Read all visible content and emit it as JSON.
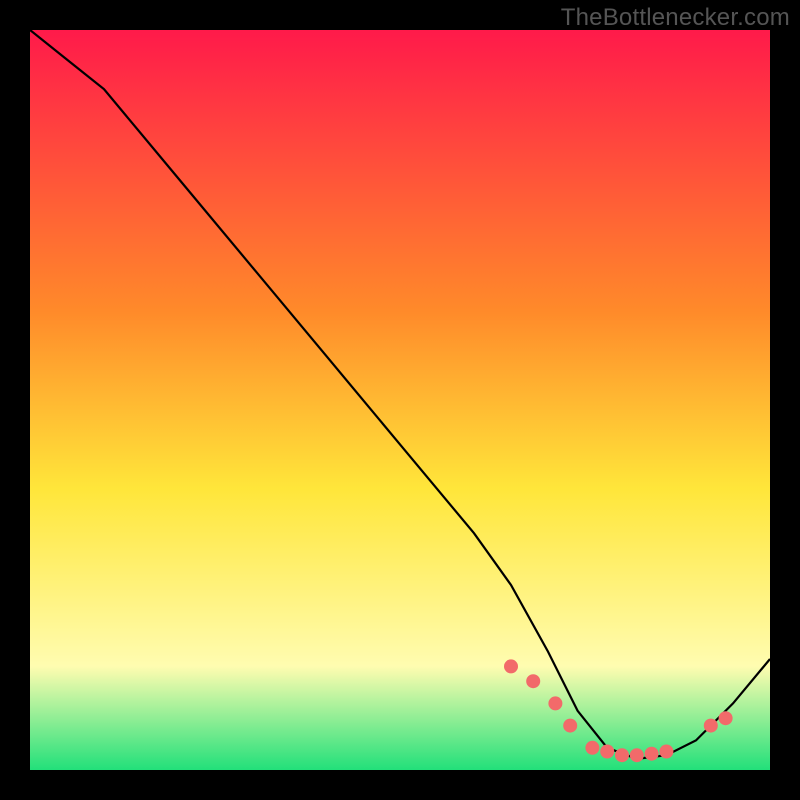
{
  "watermark": "TheBottlenecker.com",
  "colors": {
    "gradient_top": "#ff1a4a",
    "gradient_mid1": "#ff8a2a",
    "gradient_mid2": "#ffe63a",
    "gradient_low": "#fffcb0",
    "gradient_bottom": "#22e07a",
    "curve": "#000000",
    "marker": "#f26a6a"
  },
  "chart_data": {
    "type": "line",
    "title": "",
    "xlabel": "",
    "ylabel": "",
    "xlim": [
      0,
      100
    ],
    "ylim": [
      0,
      100
    ],
    "series": [
      {
        "name": "curve",
        "x": [
          0,
          5,
          10,
          20,
          30,
          40,
          50,
          60,
          65,
          70,
          74,
          78,
          82,
          86,
          90,
          95,
          100
        ],
        "y": [
          100,
          96,
          92,
          80,
          68,
          56,
          44,
          32,
          25,
          16,
          8,
          3,
          1.5,
          2,
          4,
          9,
          15
        ]
      }
    ],
    "markers": {
      "name": "points",
      "x": [
        65,
        68,
        71,
        73,
        76,
        78,
        80,
        82,
        84,
        86,
        92,
        94
      ],
      "y": [
        14,
        12,
        9,
        6,
        3,
        2.5,
        2,
        2,
        2.2,
        2.5,
        6,
        7
      ]
    }
  }
}
